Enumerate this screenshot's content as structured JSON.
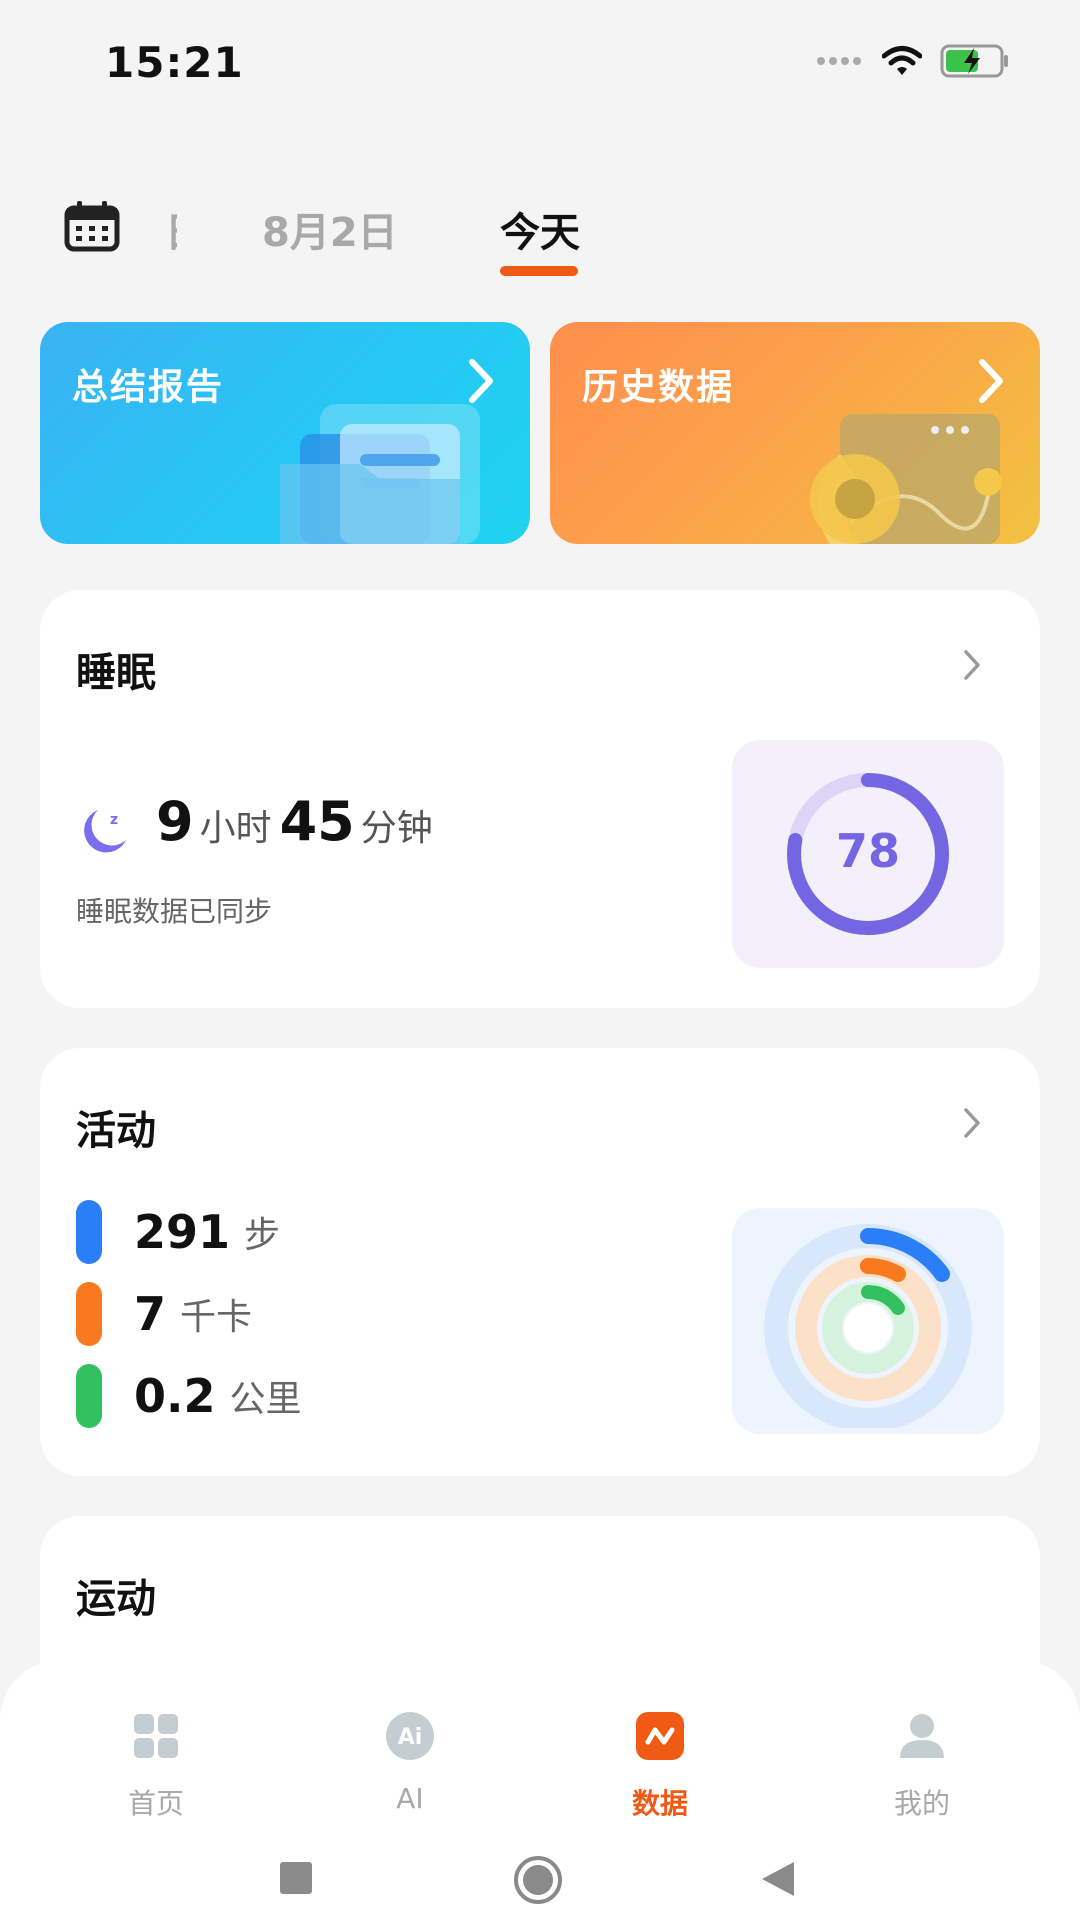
{
  "status_bar": {
    "time": "15:21"
  },
  "date_tabs": {
    "partial": "日",
    "previous": "8月2日",
    "current": "今天"
  },
  "banners": [
    {
      "title": "总结报告"
    },
    {
      "title": "历史数据"
    }
  ],
  "sleep": {
    "title": "睡眠",
    "hours": "9",
    "hours_unit": "小时",
    "minutes": "45",
    "minutes_unit": "分钟",
    "sync_text": "睡眠数据已同步",
    "score": "78",
    "score_progress": 0.78
  },
  "activity": {
    "title": "活动",
    "steps": "291",
    "steps_unit": "步",
    "calories": "7",
    "calories_unit": "千卡",
    "distance": "0.2",
    "distance_unit": "公里"
  },
  "exercise": {
    "title": "运动"
  },
  "bottom_nav": [
    {
      "label": "首页"
    },
    {
      "label": "AI"
    },
    {
      "label": "数据"
    },
    {
      "label": "我的"
    }
  ],
  "colors": {
    "accent": "#f05a14",
    "sleep_ring": "#7466e3",
    "steps": "#2a7ff6",
    "calories": "#f9791e",
    "distance": "#33c160"
  }
}
